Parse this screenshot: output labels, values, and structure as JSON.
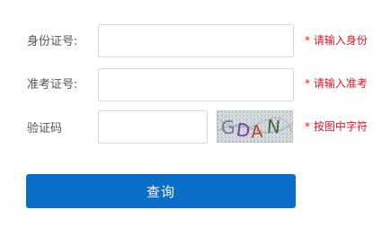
{
  "form": {
    "id_label": "身份证号:",
    "id_value": "",
    "id_hint": "* 请输入身份",
    "exam_label": "准考证号:",
    "exam_value": "",
    "exam_hint": "* 请输入准考",
    "captcha_label": "验证码",
    "captcha_value": "",
    "captcha_text": "GDAN",
    "captcha_hint": "* 按图中字符",
    "submit_label": "查询"
  },
  "colors": {
    "accent": "#0a6ec8",
    "hint": "#e0151e",
    "border": "#d9d9d9",
    "label": "#555555"
  }
}
